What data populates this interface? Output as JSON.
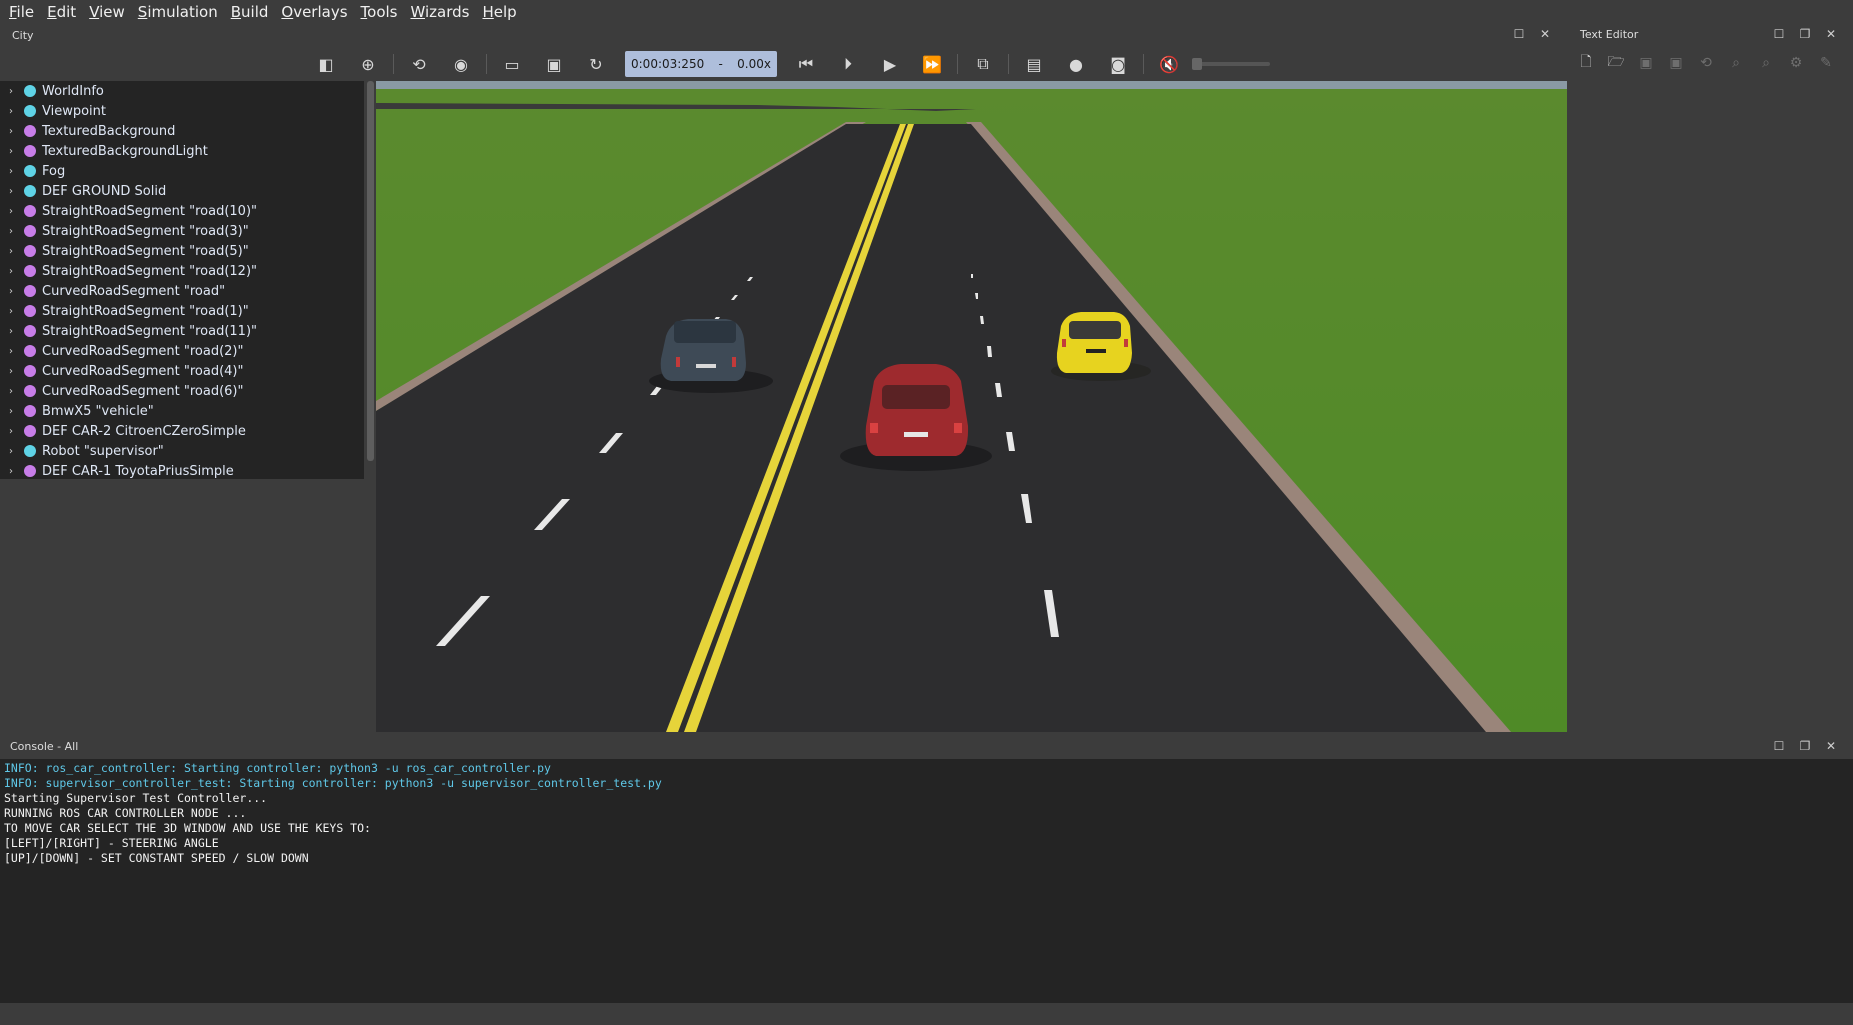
{
  "menubar": {
    "items": [
      "File",
      "Edit",
      "View",
      "Simulation",
      "Build",
      "Overlays",
      "Tools",
      "Wizards",
      "Help"
    ]
  },
  "scene_panel": {
    "title": "City"
  },
  "text_editor": {
    "title": "Text Editor",
    "toolbar_icons": [
      "new-file-icon",
      "open-file-icon",
      "save-icon",
      "save-all-icon",
      "revert-icon",
      "find-icon",
      "replace-icon",
      "settings-icon",
      "build-icon"
    ]
  },
  "toolbar": {
    "time": "0:00:03:250",
    "separator": "-",
    "speed": "0.00x"
  },
  "scene_tree": {
    "items": [
      {
        "label": "WorldInfo",
        "color": "#5fd3e6"
      },
      {
        "label": "Viewpoint",
        "color": "#5fd3e6"
      },
      {
        "label": "TexturedBackground",
        "color": "#c77de8"
      },
      {
        "label": "TexturedBackgroundLight",
        "color": "#c77de8"
      },
      {
        "label": "Fog",
        "color": "#5fd3e6"
      },
      {
        "label": "DEF GROUND Solid",
        "color": "#5fd3e6"
      },
      {
        "label": "StraightRoadSegment \"road(10)\"",
        "color": "#c77de8"
      },
      {
        "label": "StraightRoadSegment \"road(3)\"",
        "color": "#c77de8"
      },
      {
        "label": "StraightRoadSegment \"road(5)\"",
        "color": "#c77de8"
      },
      {
        "label": "StraightRoadSegment \"road(12)\"",
        "color": "#c77de8"
      },
      {
        "label": "CurvedRoadSegment \"road\"",
        "color": "#c77de8"
      },
      {
        "label": "StraightRoadSegment \"road(1)\"",
        "color": "#c77de8"
      },
      {
        "label": "StraightRoadSegment \"road(11)\"",
        "color": "#c77de8"
      },
      {
        "label": "CurvedRoadSegment \"road(2)\"",
        "color": "#c77de8"
      },
      {
        "label": "CurvedRoadSegment \"road(4)\"",
        "color": "#c77de8"
      },
      {
        "label": "CurvedRoadSegment \"road(6)\"",
        "color": "#c77de8"
      },
      {
        "label": "BmwX5 \"vehicle\"",
        "color": "#c77de8"
      },
      {
        "label": "DEF CAR-2 CitroenCZeroSimple",
        "color": "#c77de8"
      },
      {
        "label": "Robot \"supervisor\"",
        "color": "#5fd3e6"
      },
      {
        "label": "DEF CAR-1 ToyotaPriusSimple",
        "color": "#c77de8"
      }
    ]
  },
  "console": {
    "title": "Console - All",
    "lines": [
      {
        "text": "INFO: ros_car_controller: Starting controller: python3 -u ros_car_controller.py",
        "color": "#5fc8e8"
      },
      {
        "text": "INFO: supervisor_controller_test: Starting controller: python3 -u supervisor_controller_test.py",
        "color": "#5fc8e8"
      },
      {
        "text": "Starting Supervisor Test Controller...",
        "color": "#f2f2f2"
      },
      {
        "text": "RUNNING ROS CAR CONTROLLER NODE ...",
        "color": "#f2f2f2"
      },
      {
        "text": "TO MOVE CAR SELECT THE 3D WINDOW AND USE THE KEYS TO:",
        "color": "#f2f2f2"
      },
      {
        "text": "[LEFT]/[RIGHT] - STEERING ANGLE",
        "color": "#f2f2f2"
      },
      {
        "text": "[UP]/[DOWN] - SET CONSTANT SPEED / SLOW DOWN",
        "color": "#f2f2f2"
      }
    ]
  }
}
